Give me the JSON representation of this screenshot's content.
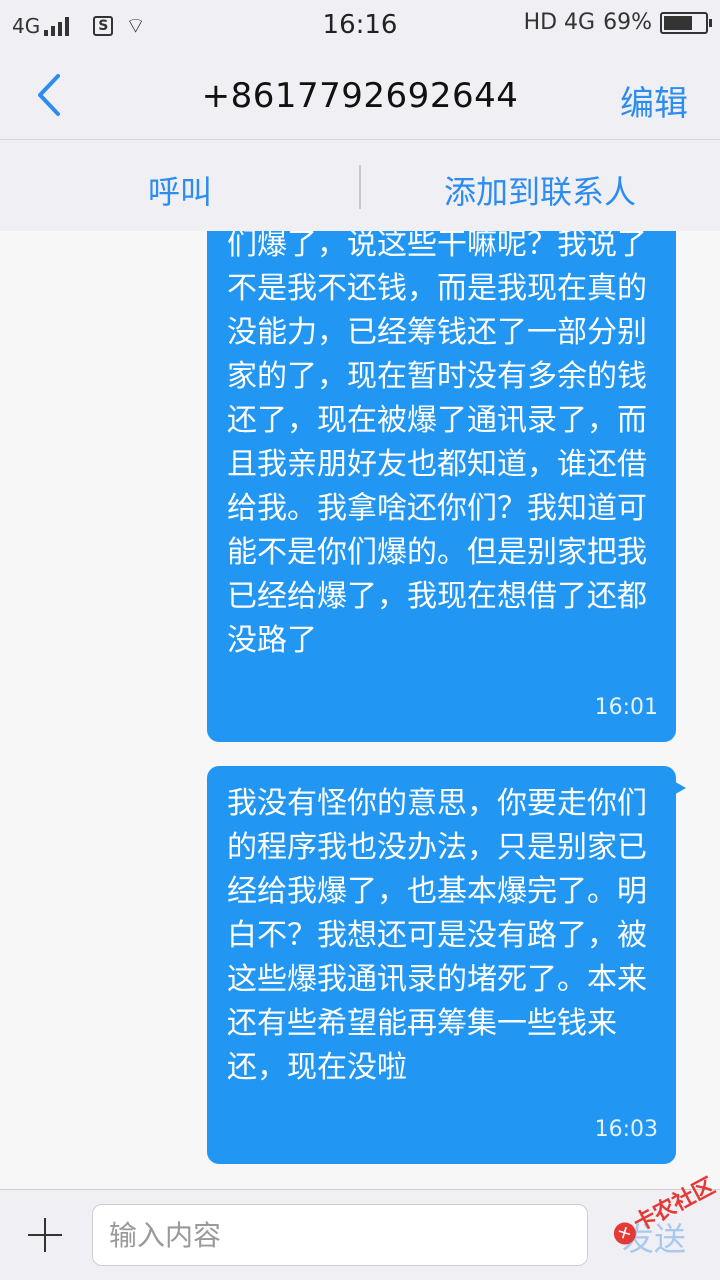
{
  "status_bar": {
    "network": "4G",
    "time": "16:16",
    "hd_network": "HD 4G",
    "battery": "69%",
    "battery_level": 0.69
  },
  "header": {
    "title": "+8617792692644",
    "edit_label": "编辑",
    "back_icon": "chevron-left-icon"
  },
  "actions": {
    "call_label": "呼叫",
    "add_contact_label": "添加到联系人"
  },
  "messages": [
    {
      "text": "们爆了，说这些干嘛呢？我说了不是我不还钱，而是我现在真的没能力，已经筹钱还了一部分别家的了，现在暂时没有多余的钱还了，现在被爆了通讯录了，而且我亲朋好友也都知道，谁还借给我。我拿啥还你们？我知道可能不是你们爆的。但是别家把我已经给爆了，我现在想借了还都没路了",
      "time": "16:01"
    },
    {
      "text": "我没有怪你的意思，你要走你们的程序我也没办法，只是别家已经给我爆了，也基本爆完了。明白不？我想还可是没有路了，被这些爆我通讯录的堵死了。本来还有些希望能再筹集一些钱来还，现在没啦",
      "time": "16:03"
    }
  ],
  "input": {
    "placeholder": "输入内容",
    "send_label": "发送"
  },
  "watermark": {
    "text": "卡农社区"
  },
  "colors": {
    "accent": "#2d8cf0",
    "bubble": "#2196f3",
    "background": "#efeff4"
  }
}
